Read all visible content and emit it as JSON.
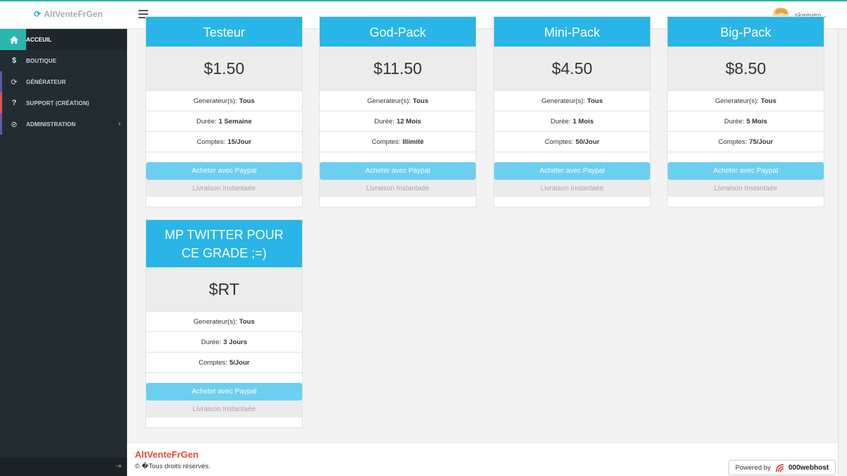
{
  "header": {
    "brand": "AltVenteFrGen",
    "brand_icon": "refresh-icon",
    "username": "skeeven",
    "accent": "#2ab5b1"
  },
  "sidebar": {
    "items": [
      {
        "label": "ACCEUIL",
        "icon": "home-icon",
        "active": true
      },
      {
        "label": "BOUTIQUE",
        "icon": "dollar-icon"
      },
      {
        "label": "GÉNÉRATEUR",
        "icon": "refresh-icon"
      },
      {
        "label": "SUPPORT (CRÉATION)",
        "icon": "question-icon"
      },
      {
        "label": "ADMINISTRATION",
        "icon": "ban-icon"
      }
    ]
  },
  "packs": [
    {
      "name": "Testeur",
      "price": "$1.50",
      "gen_label": "Generateur(s):",
      "gen": "Tous",
      "dur_label": "Durée:",
      "dur": "1 Semaine",
      "acc_label": "Comptes:",
      "acc": "15/Jour",
      "buy": "Acheter avec Paypal",
      "delivery": "Livraison Instantaée"
    },
    {
      "name": "God-Pack",
      "price": "$11.50",
      "gen_label": "Generateur(s):",
      "gen": "Tous",
      "dur_label": "Durée:",
      "dur": "12 Mois",
      "acc_label": "Comptes:",
      "acc": "Illimité",
      "buy": "Acheter avec Paypal",
      "delivery": "Livraison Instantaée"
    },
    {
      "name": "Mini-Pack",
      "price": "$4.50",
      "gen_label": "Generateur(s):",
      "gen": "Tous",
      "dur_label": "Durée:",
      "dur": "1 Mois",
      "acc_label": "Comptes:",
      "acc": "50/Jour",
      "buy": "Acheter avec Paypal",
      "delivery": "Livraison Instantaée"
    },
    {
      "name": "Big-Pack",
      "price": "$8.50",
      "gen_label": "Generateur(s):",
      "gen": "Tous",
      "dur_label": "Durée:",
      "dur": "5 Mois",
      "acc_label": "Comptes:",
      "acc": "75/Jour",
      "buy": "Acheter avec Paypal",
      "delivery": "Livraison Instantaée"
    },
    {
      "name": "MP TWITTER POUR CE GRADE ;=)",
      "price": "$RT",
      "gen_label": "Generateur(s):",
      "gen": "Tous",
      "dur_label": "Durée:",
      "dur": "3 Jours",
      "acc_label": "Comptes:",
      "acc": "5/Jour",
      "buy": "Acheter avec Paypal",
      "delivery": "Livraison Instantaée"
    }
  ],
  "footer": {
    "brand": "AltVenteFrGen",
    "copyright": "© �Tous droits réservés.",
    "powered_label": "Powered by",
    "host_name": "000webhost"
  }
}
